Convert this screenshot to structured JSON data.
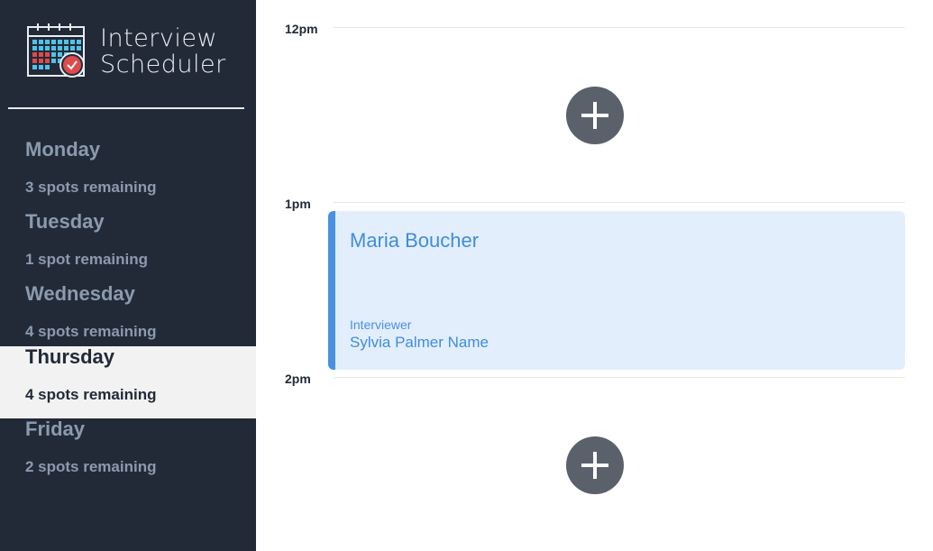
{
  "app": {
    "title_line1": "Interview",
    "title_line2": "Scheduler",
    "logo_icon": "calendar-check-icon",
    "colors": {
      "sidebar_bg": "#222a38",
      "accent_blue": "#4a90e2",
      "appointment_bg": "#e3eefc",
      "add_button": "#5a616b",
      "check_red": "#e04a4a"
    }
  },
  "days": [
    {
      "name": "Monday",
      "spots": "3 spots remaining",
      "selected": false
    },
    {
      "name": "Tuesday",
      "spots": "1 spot remaining",
      "selected": false
    },
    {
      "name": "Wednesday",
      "spots": "4 spots remaining",
      "selected": false
    },
    {
      "name": "Thursday",
      "spots": "4 spots remaining",
      "selected": true
    },
    {
      "name": "Friday",
      "spots": "2 spots remaining",
      "selected": false
    }
  ],
  "schedule": {
    "slots": [
      {
        "time": "12pm",
        "type": "empty",
        "add_icon": "plus-icon"
      },
      {
        "time": "1pm",
        "type": "booked",
        "student": "Maria Boucher",
        "interviewer_label": "Interviewer",
        "interviewer": "Sylvia Palmer Name"
      },
      {
        "time": "2pm",
        "type": "empty",
        "add_icon": "plus-icon"
      }
    ]
  }
}
